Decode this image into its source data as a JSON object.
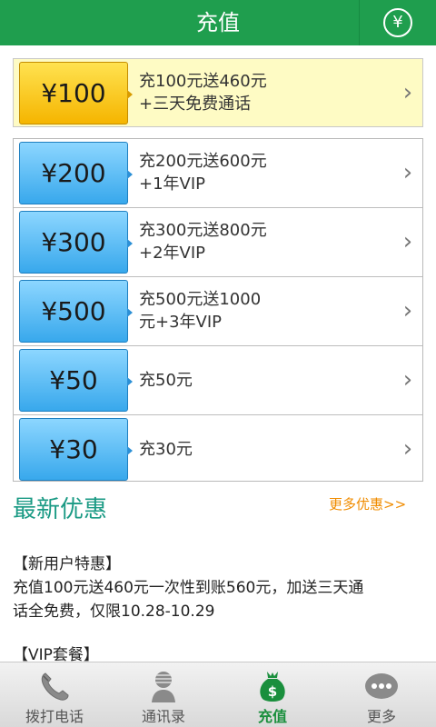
{
  "header": {
    "title": "充值",
    "yen_button": "¥"
  },
  "featured": {
    "price": "¥100",
    "line1": "充100元送460元",
    "line2": "+三天免费通话"
  },
  "packages": [
    {
      "price": "¥200",
      "line1": "充200元送600元",
      "line2": "+1年VIP"
    },
    {
      "price": "¥300",
      "line1": "充300元送800元",
      "line2": "+2年VIP"
    },
    {
      "price": "¥500",
      "line1": "充500元送1000",
      "line2": "元+3年VIP"
    },
    {
      "price": "¥50",
      "line1": "充50元",
      "line2": ""
    },
    {
      "price": "¥30",
      "line1": "充30元",
      "line2": ""
    }
  ],
  "chevron": "›",
  "promotions": {
    "title": "最新优惠",
    "more": "更多优惠>>",
    "items": [
      {
        "heading": "【新用户特惠】",
        "line1": "充值100元送460元一次性到账560元，加送三天通",
        "line2": "话全免费，仅限10.28-10.29"
      },
      {
        "heading": "【VIP套餐】"
      }
    ]
  },
  "tabs": [
    {
      "label": "拨打电话",
      "icon": "phone-icon"
    },
    {
      "label": "通讯录",
      "icon": "contacts-icon"
    },
    {
      "label": "充值",
      "icon": "money-bag-icon",
      "active": true
    },
    {
      "label": "更多",
      "icon": "more-icon"
    }
  ],
  "colors": {
    "header": "#1f9e4e",
    "accent_teal": "#1a9a84",
    "link_orange": "#f08c00",
    "active_tab": "#1a8f3d"
  }
}
